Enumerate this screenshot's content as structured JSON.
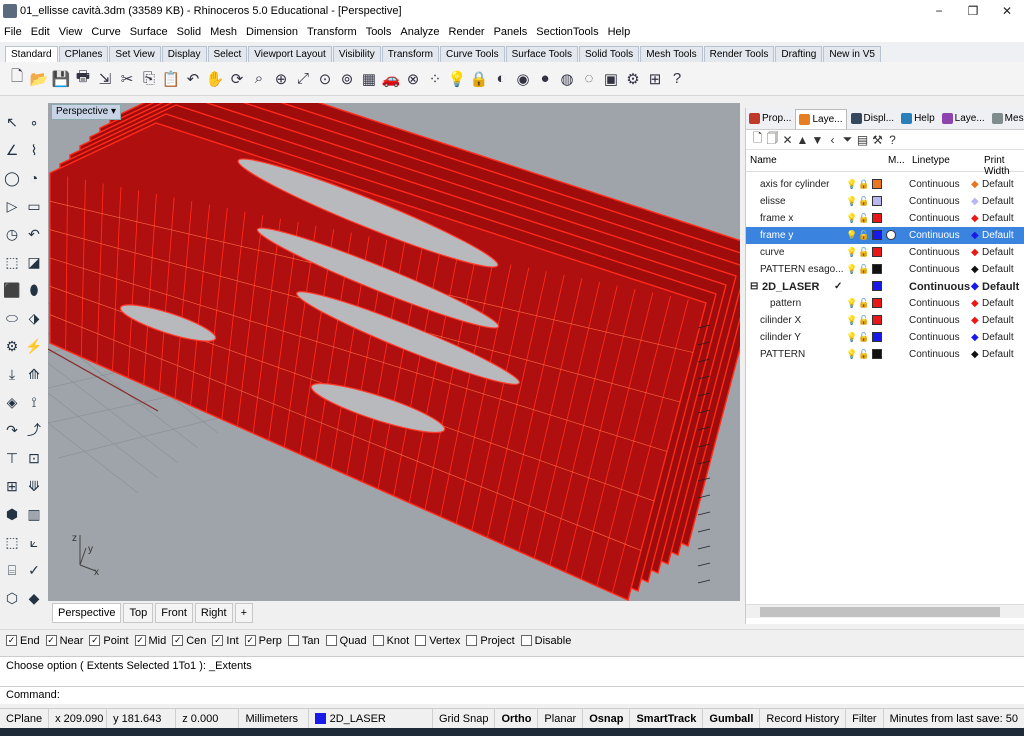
{
  "window": {
    "title": "01_ellisse cavità.3dm (33589 KB) - Rhinoceros 5.0 Educational - [Perspective]",
    "minimize": "−",
    "maximize": "❐",
    "close": "✕"
  },
  "menu": [
    "File",
    "Edit",
    "View",
    "Curve",
    "Surface",
    "Solid",
    "Mesh",
    "Dimension",
    "Transform",
    "Tools",
    "Analyze",
    "Render",
    "Panels",
    "SectionTools",
    "Help"
  ],
  "toolbar_tabs": [
    "Standard",
    "CPlanes",
    "Set View",
    "Display",
    "Select",
    "Viewport Layout",
    "Visibility",
    "Transform",
    "Curve Tools",
    "Surface Tools",
    "Solid Tools",
    "Mesh Tools",
    "Render Tools",
    "Drafting",
    "New in V5"
  ],
  "toolbar_icons": [
    "new-icon",
    "open-icon",
    "save-icon",
    "print-icon",
    "import-icon",
    "cut-icon",
    "copy-icon",
    "paste-icon",
    "undo-icon",
    "pan-icon",
    "rotate-view-icon",
    "zoom-window-icon",
    "zoom-dynamic-icon",
    "zoom-extents-icon",
    "zoom-selected-icon",
    "zoom-all-icon",
    "four-view-icon",
    "car-icon",
    "osnap-icon",
    "point-icon",
    "light-icon",
    "lock-icon",
    "layer-color-icon",
    "color-wheel-icon",
    "render-sphere-icon",
    "shaded-sphere-icon",
    "ghosted-sphere-icon",
    "properties-icon",
    "gear-icon",
    "grid-icon",
    "help-icon"
  ],
  "viewport": {
    "label": "Perspective",
    "tabs": [
      "Perspective",
      "Top",
      "Front",
      "Right"
    ],
    "add_tab": "+",
    "axis": {
      "x": "x",
      "y": "y",
      "z": "z"
    }
  },
  "panel": {
    "tabs": [
      "Prop...",
      "Laye...",
      "Displ...",
      "Help",
      "Laye...",
      "Mesh..."
    ],
    "columns": {
      "name": "Name",
      "material": "M...",
      "linetype": "Linetype",
      "print_width": "Print Width"
    },
    "layers": [
      {
        "name": "axis for cylinder",
        "color": "#e87722",
        "linetype": "Continuous",
        "print_width": "Default",
        "diamond": "#e87722",
        "selected": false,
        "bold": false,
        "indent": 1,
        "bulb": "#d4b300",
        "lock": "🔒"
      },
      {
        "name": "elisse",
        "color": "#b9b7f0",
        "linetype": "Continuous",
        "print_width": "Default",
        "diamond": "#b9b7f0",
        "selected": false,
        "bold": false,
        "indent": 1,
        "bulb": "#d4b300",
        "lock": "🔓"
      },
      {
        "name": "frame x",
        "color": "#e81818",
        "linetype": "Continuous",
        "print_width": "Default",
        "diamond": "#e81818",
        "selected": false,
        "bold": false,
        "indent": 1,
        "bulb": "#d4b300",
        "lock": "🔓"
      },
      {
        "name": "frame y",
        "color": "#1a1ae8",
        "linetype": "Continuous",
        "print_width": "Default",
        "diamond": "#1a1ae8",
        "selected": true,
        "bold": false,
        "indent": 1,
        "bulb": "#d4b300",
        "lock": "🔓"
      },
      {
        "name": "curve",
        "color": "#e81818",
        "linetype": "Continuous",
        "print_width": "Default",
        "diamond": "#e81818",
        "selected": false,
        "bold": false,
        "indent": 1,
        "bulb": "#d4b300",
        "lock": "🔓"
      },
      {
        "name": "PATTERN esago...",
        "color": "#111111",
        "linetype": "Continuous",
        "print_width": "Default",
        "diamond": "#111111",
        "selected": false,
        "bold": false,
        "indent": 1,
        "bulb": "#2d7fd8",
        "lock": "🔓"
      },
      {
        "name": "2D_LASER",
        "color": "#1a1ae8",
        "linetype": "Continuous",
        "print_width": "Default",
        "diamond": "#1a1ae8",
        "selected": false,
        "bold": true,
        "indent": 0,
        "bulb": "",
        "lock": "",
        "check": "✓",
        "expander": "⊟"
      },
      {
        "name": "pattern",
        "color": "#e81818",
        "linetype": "Continuous",
        "print_width": "Default",
        "diamond": "#e81818",
        "selected": false,
        "bold": false,
        "indent": 2,
        "bulb": "#d4b300",
        "lock": "🔓"
      },
      {
        "name": "cilinder X",
        "color": "#e81818",
        "linetype": "Continuous",
        "print_width": "Default",
        "diamond": "#e81818",
        "selected": false,
        "bold": false,
        "indent": 1,
        "bulb": "#2d7fd8",
        "lock": "🔓"
      },
      {
        "name": "cilinder Y",
        "color": "#1a1ae8",
        "linetype": "Continuous",
        "print_width": "Default",
        "diamond": "#1a1ae8",
        "selected": false,
        "bold": false,
        "indent": 1,
        "bulb": "#2d7fd8",
        "lock": "🔓"
      },
      {
        "name": "PATTERN",
        "color": "#111111",
        "linetype": "Continuous",
        "print_width": "Default",
        "diamond": "#111111",
        "selected": false,
        "bold": false,
        "indent": 1,
        "bulb": "#d4b300",
        "lock": "🔓"
      }
    ]
  },
  "osnap": [
    {
      "label": "End",
      "checked": true
    },
    {
      "label": "Near",
      "checked": true
    },
    {
      "label": "Point",
      "checked": true
    },
    {
      "label": "Mid",
      "checked": true
    },
    {
      "label": "Cen",
      "checked": true
    },
    {
      "label": "Int",
      "checked": true
    },
    {
      "label": "Perp",
      "checked": true
    },
    {
      "label": "Tan",
      "checked": false
    },
    {
      "label": "Quad",
      "checked": false
    },
    {
      "label": "Knot",
      "checked": false
    },
    {
      "label": "Vertex",
      "checked": false
    },
    {
      "label": "Project",
      "checked": false
    },
    {
      "label": "Disable",
      "checked": false
    }
  ],
  "command": {
    "history": "Choose option ( Extents  Selected  1To1 ): _Extents",
    "prompt": "Command:",
    "value": ""
  },
  "status": {
    "cplane": "CPlane",
    "x": "x 209.090",
    "y": "y 181.643",
    "z": "z 0.000",
    "units": "Millimeters",
    "layer": "2D_LASER",
    "layer_color": "#1a1ae8",
    "grid_snap": "Grid Snap",
    "ortho": "Ortho",
    "planar": "Planar",
    "osnap": "Osnap",
    "smarttrack": "SmartTrack",
    "gumball": "Gumball",
    "record_history": "Record History",
    "filter": "Filter",
    "minutes": "Minutes from last save: 50"
  },
  "colors": {
    "panel_red": "#b00f0f",
    "edge_red": "#ff2a1a",
    "viewport_bg": "#9ea4a9",
    "selection": "#3a84e0"
  }
}
